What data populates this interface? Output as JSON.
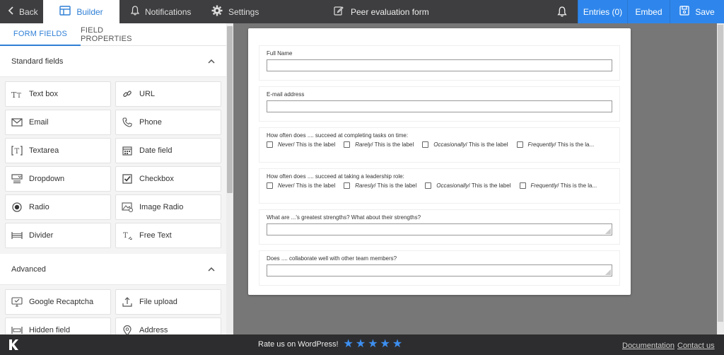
{
  "topbar": {
    "back_label": "Back",
    "builder_label": "Builder",
    "notifications_label": "Notifications",
    "settings_label": "Settings",
    "form_title": "Peer evaluation form",
    "entries_label": "Entries (0)",
    "embed_label": "Embed",
    "save_label": "Save"
  },
  "sidebar": {
    "tabs": [
      {
        "label": "FORM FIELDS",
        "active": true
      },
      {
        "label": "FIELD PROPERTIES",
        "active": false
      }
    ],
    "standard_header": "Standard fields",
    "standard_fields": [
      {
        "label": "Text box",
        "icon": "text-box-icon"
      },
      {
        "label": "URL",
        "icon": "link-icon"
      },
      {
        "label": "Email",
        "icon": "envelope-icon"
      },
      {
        "label": "Phone",
        "icon": "phone-icon"
      },
      {
        "label": "Textarea",
        "icon": "textarea-icon"
      },
      {
        "label": "Date field",
        "icon": "calendar-icon"
      },
      {
        "label": "Dropdown",
        "icon": "dropdown-icon"
      },
      {
        "label": "Checkbox",
        "icon": "checkbox-icon"
      },
      {
        "label": "Radio",
        "icon": "radio-icon"
      },
      {
        "label": "Image Radio",
        "icon": "image-radio-icon"
      },
      {
        "label": "Divider",
        "icon": "divider-icon"
      },
      {
        "label": "Free Text",
        "icon": "free-text-icon"
      }
    ],
    "advanced_header": "Advanced",
    "advanced_fields": [
      {
        "label": "Google Recaptcha",
        "icon": "recaptcha-icon"
      },
      {
        "label": "File upload",
        "icon": "upload-icon"
      },
      {
        "label": "Hidden field",
        "icon": "hidden-field-icon"
      },
      {
        "label": "Address",
        "icon": "map-pin-icon"
      }
    ]
  },
  "form": {
    "full_name_label": "Full Name",
    "email_label": "E-mail address",
    "q1": {
      "label": "How often does .... succeed at completing tasks on time:",
      "options": [
        {
          "em": "Never",
          "rest": " / This is the label"
        },
        {
          "em": "Rarely",
          "rest": " / This is the label"
        },
        {
          "em": "Occasionally",
          "rest": " / This is the label"
        },
        {
          "em": "Frequently",
          "rest": " / This is the la..."
        }
      ]
    },
    "q2": {
      "label": "How often does .... succeed at taking a leadership role:",
      "options": [
        {
          "em": "Never",
          "rest": " / This is the label"
        },
        {
          "em": "Raresly",
          "rest": " / This is the label"
        },
        {
          "em": "Occasionally",
          "rest": " / This is the label"
        },
        {
          "em": "Frequently",
          "rest": " / This is the la..."
        }
      ]
    },
    "q3_label": "What are ...'s greatest strengths? What about their strengths?",
    "q4_label": "Does .... collaborate well with other team members?"
  },
  "footer": {
    "rate_label": "Rate us on WordPress!",
    "stars": 5,
    "documentation_label": "Documentation",
    "contact_label": "Contact us"
  },
  "colors": {
    "accent": "#2e86ec",
    "topbar": "#3e3e40",
    "footer": "#2d2d2f"
  }
}
